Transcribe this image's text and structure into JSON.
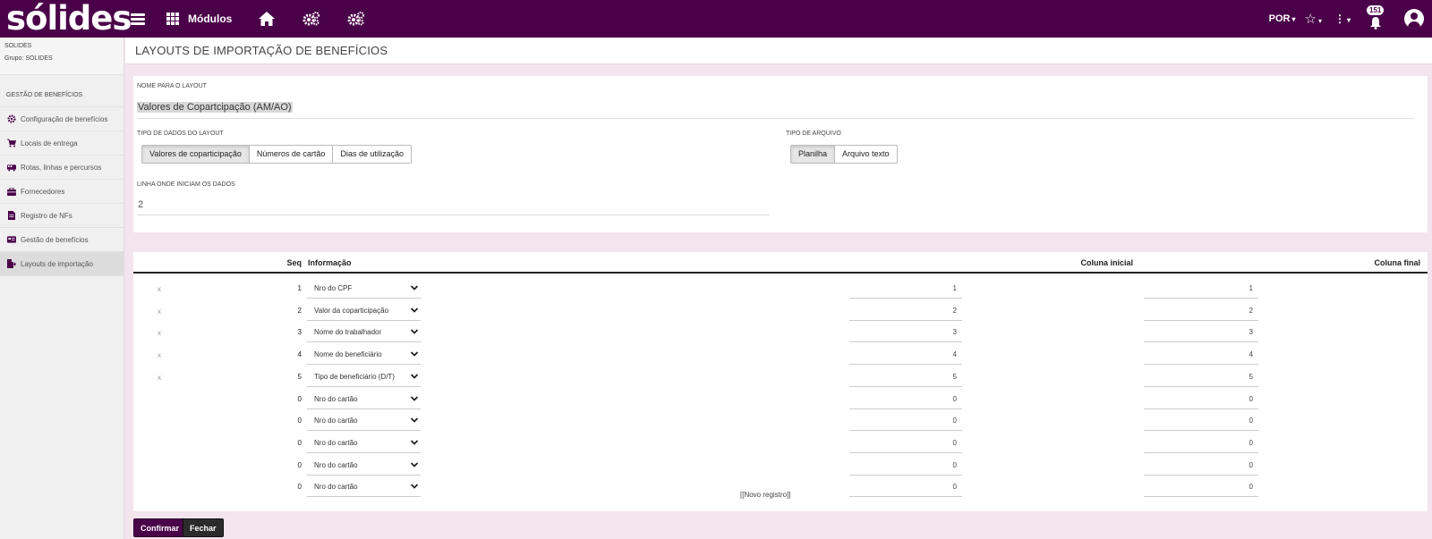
{
  "topbar": {
    "logo": "sólides",
    "modules_label": "Módulos",
    "language": "POR",
    "notifications_count": "151",
    "icons": [
      "menu-icon",
      "grid-icon",
      "home-icon",
      "gears-icon",
      "gears-icon",
      "star-icon",
      "kebab-icon",
      "bell-icon",
      "user-icon"
    ]
  },
  "sidebar": {
    "org_name": "SOLIDES",
    "org_group": "Grupo: SOLIDES",
    "section_title": "GESTÃO DE BENEFÍCIOS",
    "items": [
      {
        "label": "Configuração de benefícios",
        "icon": "gear-icon",
        "active": false
      },
      {
        "label": "Locais de entrega",
        "icon": "cart-icon",
        "active": false
      },
      {
        "label": "Rotas, linhas e percursos",
        "icon": "bus-icon",
        "active": false
      },
      {
        "label": "Fornecedores",
        "icon": "briefcase-icon",
        "active": false
      },
      {
        "label": "Registro de NFs",
        "icon": "document-icon",
        "active": false
      },
      {
        "label": "Gestão de benefícios",
        "icon": "card-icon",
        "active": false
      },
      {
        "label": "Layouts de importação",
        "icon": "import-icon",
        "active": true
      }
    ]
  },
  "page": {
    "title": "LAYOUTS DE IMPORTAÇÃO DE BENEFÍCIOS"
  },
  "form": {
    "name_label": "NOME PARA O LAYOUT",
    "name_value": "Valores de Copartcipação (AM/AO)",
    "data_type_label": "TIPO DE DADOS DO LAYOUT",
    "data_type_options": [
      "Valores de coparticipação",
      "Números de cartão",
      "Dias de utilização"
    ],
    "data_type_selected": "Valores de coparticipação",
    "file_type_label": "TIPO DE ARQUIVO",
    "file_type_options": [
      "Planilha",
      "Arquivo texto"
    ],
    "file_type_selected": "Planilha",
    "start_line_label": "LINHA ONDE INICIAM OS DADOS",
    "start_line_value": "2"
  },
  "table": {
    "headers": {
      "seq": "Seq",
      "info": "Informação",
      "col_start": "Coluna inicial",
      "col_end": "Coluna final"
    },
    "remove_label": "x",
    "rows": [
      {
        "removable": true,
        "seq": "1",
        "info": "Nro do CPF",
        "col_start": "1",
        "col_end": "1"
      },
      {
        "removable": true,
        "seq": "2",
        "info": "Valor da coparticipação",
        "col_start": "2",
        "col_end": "2"
      },
      {
        "removable": true,
        "seq": "3",
        "info": "Nome do trabalhador",
        "col_start": "3",
        "col_end": "3"
      },
      {
        "removable": true,
        "seq": "4",
        "info": "Nome do beneficiário",
        "col_start": "4",
        "col_end": "4"
      },
      {
        "removable": true,
        "seq": "5",
        "info": "Tipo de beneficiário (D/T)",
        "col_start": "5",
        "col_end": "5"
      },
      {
        "removable": false,
        "seq": "0",
        "info": "Nro do cartão",
        "col_start": "0",
        "col_end": "0"
      },
      {
        "removable": false,
        "seq": "0",
        "info": "Nro do cartão",
        "col_start": "0",
        "col_end": "0"
      },
      {
        "removable": false,
        "seq": "0",
        "info": "Nro do cartão",
        "col_start": "0",
        "col_end": "0"
      },
      {
        "removable": false,
        "seq": "0",
        "info": "Nro do cartão",
        "col_start": "0",
        "col_end": "0"
      },
      {
        "removable": false,
        "seq": "0",
        "info": "Nro do cartão",
        "col_start": "0",
        "col_end": "0"
      }
    ],
    "new_record_label": "[[Novo registro]]"
  },
  "actions": {
    "confirm_label": "Confirmar",
    "close_label": "Fechar"
  },
  "colors": {
    "brand": "#4a0049",
    "background": "#f3e4ee",
    "close_button": "#2b2b2b"
  }
}
